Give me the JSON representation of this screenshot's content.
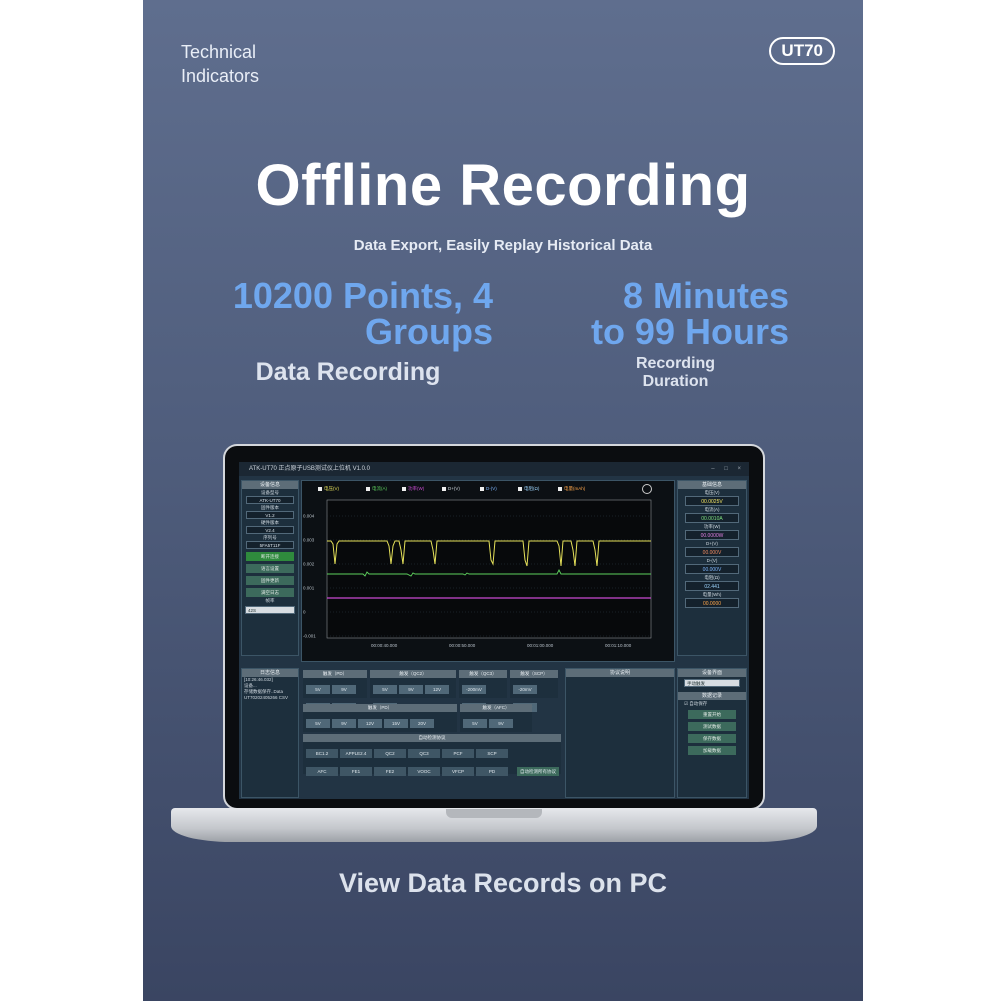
{
  "poster": {
    "tag_line1": "Technical",
    "tag_line2": "Indicators",
    "badge": "UT70",
    "title": "Offline Recording",
    "subtitle": "Data Export, Easily Replay Historical Data",
    "stat_left_line1": "10200 Points, 4",
    "stat_left_line2": "Groups",
    "stat_left_caption": "Data Recording",
    "stat_right_line1": "8 Minutes",
    "stat_right_line2": "to 99 Hours",
    "stat_right_caption_line1": "Recording",
    "stat_right_caption_line2": "Duration",
    "footer": "View Data Records on PC"
  },
  "app": {
    "title": "ATK-UT70 正点原子USB测试仪上位机 V1.0.0",
    "device_panel": {
      "header": "设备信息",
      "model_label": "设备型号",
      "model_value": "ATK-UT70",
      "firmware_label": "固件版本",
      "firmware_value": "V1.2",
      "hardware_label": "硬件版本",
      "hardware_value": "V2.4",
      "serial_label": "序列号",
      "serial_value": "5FA5T11F",
      "buttons": [
        "断开连接",
        "语言设置",
        "固件更新",
        "满空日志"
      ],
      "baud_label": "帧率",
      "baud_value": "42S"
    },
    "legend": [
      "电压(V)",
      "电流(A)",
      "功率(W)",
      "D+(V)",
      "D-(V)",
      "电阻(Ω)",
      "电量(mAh)"
    ],
    "y_ticks": [
      "0.004",
      "0.003",
      "0.002",
      "0.001",
      "0",
      "-0.001"
    ],
    "x_ticks": [
      "00:00:40.000",
      "00:00:50.000",
      "00:01:00.000",
      "00:01:10.000"
    ],
    "realtime_panel": {
      "header": "基础信息",
      "items": [
        {
          "label": "电压(V)",
          "value": "00.0025V",
          "color": "#f5e663"
        },
        {
          "label": "电流(A)",
          "value": "00.0010A",
          "color": "#7fe07f"
        },
        {
          "label": "功率(W)",
          "value": "00.0000W",
          "color": "#e07fe0"
        },
        {
          "label": "D+(V)",
          "value": "00.000V",
          "color": "#f08a60"
        },
        {
          "label": "D-(V)",
          "value": "00.000V",
          "color": "#7fb7ff"
        },
        {
          "label": "电阻(Ω)",
          "value": "02.441",
          "color": "#9fd7ff"
        },
        {
          "label": "电量(Wh)",
          "value": "00.0000",
          "color": "#ffa64a"
        }
      ]
    },
    "log_panel": {
      "header": "日志信息",
      "lines": [
        "[10:26:46.032]",
        "设备...",
        "存储数据保存..Data",
        "UT70202405266 CSV"
      ]
    },
    "trigger_groups": [
      {
        "title": "触发（PD）",
        "pills": [
          "5V",
          "9V",
          "12V",
          "15V"
        ]
      },
      {
        "title": "触发（QC2）",
        "pills": [
          "5V",
          "9V",
          "12V",
          "20V"
        ]
      },
      {
        "title": "触发（QC3）",
        "pills": [
          "-200mV",
          "+200mV"
        ]
      },
      {
        "title": "触发（SCP）",
        "pills": [
          "-20mV",
          "+20mV"
        ]
      }
    ],
    "trigger_groups2": [
      {
        "title": "触发（PD）",
        "pills": [
          "5V",
          "9V",
          "12V",
          "15V",
          "20V",
          "PPS"
        ]
      },
      {
        "title": "触发（AFC）",
        "pills": [
          "5V",
          "9V",
          "12V"
        ]
      }
    ],
    "protocol_panel": {
      "header": "协议说明"
    },
    "auto_detect": {
      "header": "自动检测协议",
      "row1": [
        "BC1.2",
        "APPLE2.4",
        "QC2",
        "QC3",
        "PCF",
        "SCP"
      ],
      "row2": [
        "AFC",
        "FE1",
        "FE2",
        "VOOC",
        "VFCP",
        "PD"
      ],
      "action": "自动检测所有协议"
    },
    "settings_panel": {
      "header": "设备界面",
      "select": "手动触发",
      "record_header": "数据记录",
      "auto_save": "自动保存",
      "buttons": [
        "重置开始",
        "测试数据",
        "保存数据",
        "加载数据"
      ]
    }
  },
  "colors": {
    "accent_blue": "#6fa7ee",
    "trace_voltage": "#e5e15a",
    "trace_current": "#5ed15e",
    "trace_power": "#c94ad1"
  }
}
